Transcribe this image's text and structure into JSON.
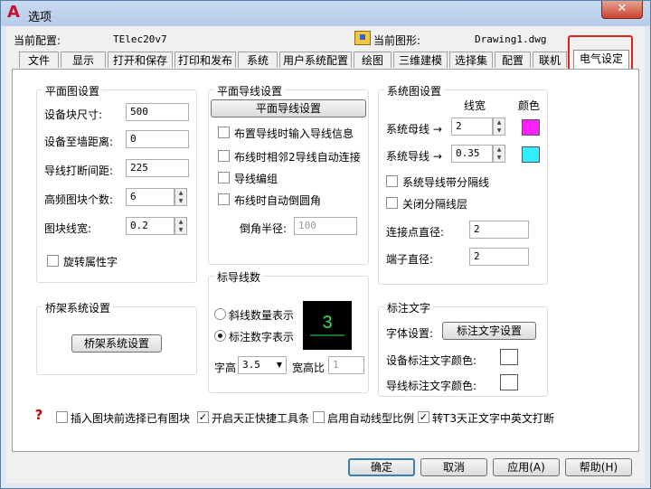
{
  "window": {
    "title": "选项",
    "close_glyph": "✕"
  },
  "header": {
    "profile_label": "当前配置:",
    "profile_value": "TElec20v7",
    "drawing_label": "当前图形:",
    "drawing_value": "Drawing1.dwg"
  },
  "tabs": [
    {
      "label": "文件"
    },
    {
      "label": "显示"
    },
    {
      "label": "打开和保存"
    },
    {
      "label": "打印和发布"
    },
    {
      "label": "系统"
    },
    {
      "label": "用户系统配置"
    },
    {
      "label": "绘图"
    },
    {
      "label": "三维建模"
    },
    {
      "label": "选择集"
    },
    {
      "label": "配置"
    },
    {
      "label": "联机"
    },
    {
      "label": "电气设定",
      "active": true
    }
  ],
  "plan": {
    "title": "平面图设置",
    "block_size_label": "设备块尺寸:",
    "block_size": "500",
    "wall_dist_label": "设备至墙距离:",
    "wall_dist": "0",
    "wire_gap_label": "导线打断间距:",
    "wire_gap": "225",
    "hf_count_label": "高频图块个数:",
    "hf_count": "6",
    "block_width_label": "图块线宽:",
    "block_width": "0.2",
    "rotate_attr_label": "旋转属性字"
  },
  "plan_wire": {
    "title": "平面导线设置",
    "button": "平面导线设置",
    "opt1": "布置导线时输入导线信息",
    "opt2": "布线时相邻2导线自动连接",
    "opt3": "导线编组",
    "opt4": "布线时自动倒圆角",
    "chamfer_label": "倒角半径:",
    "chamfer_value": "100"
  },
  "system": {
    "title": "系统图设置",
    "col_width": "线宽",
    "col_color": "颜色",
    "bus_label": "系统母线 →",
    "bus_width": "2",
    "bus_color": "#ff20ff",
    "wire_label": "系统导线 →",
    "wire_width": "0.35",
    "wire_color": "#30f0ff",
    "gap_line_label": "系统导线带分隔线",
    "close_gap_label": "关闭分隔线层",
    "dot_label": "连接点直径:",
    "dot_value": "2",
    "terminal_label": "端子直径:",
    "terminal_value": "2"
  },
  "tray": {
    "title": "桥架系统设置",
    "button": "桥架系统设置"
  },
  "wire_count": {
    "title": "标导线数",
    "opt_slash": "斜线数量表示",
    "opt_number": "标注数字表示",
    "height_label": "字高",
    "height_value": "3.5",
    "ratio_label": "宽高比",
    "ratio_value": "1",
    "preview_number": "3",
    "preview_color": "#30e060"
  },
  "annot": {
    "title": "标注文字",
    "font_label": "字体设置:",
    "font_button": "标注文字设置",
    "equip_color_label": "设备标注文字颜色:",
    "wire_color_label": "导线标注文字颜色:"
  },
  "bottom": {
    "opt1": "插入图块前选择已有图块",
    "opt2": "开启天正快捷工具条",
    "opt3": "启用自动线型比例",
    "opt4": "转T3天正文字中英文打断"
  },
  "footer": {
    "ok": "确定",
    "cancel": "取消",
    "apply": "应用(A)",
    "help": "帮助(H)"
  }
}
